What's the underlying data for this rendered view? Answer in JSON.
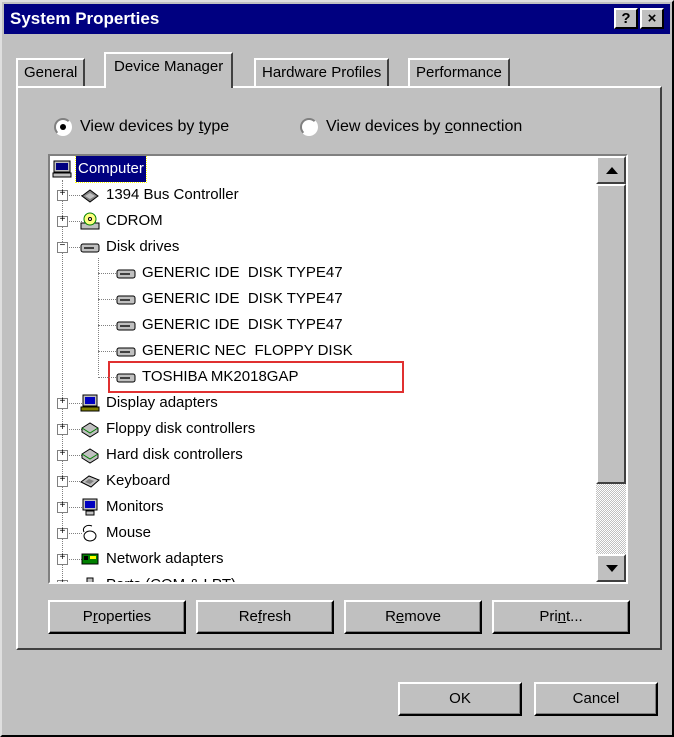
{
  "window": {
    "title": "System Properties"
  },
  "titlebar_buttons": {
    "help": "?",
    "close": "×"
  },
  "tabs": [
    {
      "label": "General",
      "active": false
    },
    {
      "label": "Device Manager",
      "active": true
    },
    {
      "label": "Hardware Profiles",
      "active": false
    },
    {
      "label": "Performance",
      "active": false
    }
  ],
  "view_options": {
    "by_type": {
      "pre": "View devices by ",
      "key": "t",
      "post": "ype",
      "checked": true
    },
    "by_connection": {
      "pre": "View devices by ",
      "key": "c",
      "post": "onnection",
      "checked": false
    }
  },
  "tree": {
    "root": "Computer",
    "items": [
      {
        "label": "1394 Bus Controller",
        "icon": "bus-controller-icon",
        "expander": "+"
      },
      {
        "label": "CDROM",
        "icon": "cdrom-icon",
        "expander": "+"
      },
      {
        "label": "Disk drives",
        "icon": "disk-drive-icon",
        "expander": "−"
      },
      {
        "label": "GENERIC IDE  DISK TYPE47",
        "icon": "disk-drive-icon",
        "child": true
      },
      {
        "label": "GENERIC IDE  DISK TYPE47",
        "icon": "disk-drive-icon",
        "child": true
      },
      {
        "label": "GENERIC IDE  DISK TYPE47",
        "icon": "disk-drive-icon",
        "child": true
      },
      {
        "label": "GENERIC NEC  FLOPPY DISK",
        "icon": "disk-drive-icon",
        "child": true
      },
      {
        "label": "TOSHIBA MK2018GAP",
        "icon": "disk-drive-icon",
        "child": true
      },
      {
        "label": "Display adapters",
        "icon": "display-adapter-icon",
        "expander": "+"
      },
      {
        "label": "Floppy disk controllers",
        "icon": "controller-icon",
        "expander": "+"
      },
      {
        "label": "Hard disk controllers",
        "icon": "controller-icon",
        "expander": "+"
      },
      {
        "label": "Keyboard",
        "icon": "keyboard-icon",
        "expander": "+"
      },
      {
        "label": "Monitors",
        "icon": "monitor-icon",
        "expander": "+"
      },
      {
        "label": "Mouse",
        "icon": "mouse-icon",
        "expander": "+"
      },
      {
        "label": "Network adapters",
        "icon": "network-adapter-icon",
        "expander": "+"
      },
      {
        "label": "Ports (COM & LPT)",
        "icon": "port-icon",
        "expander": "+"
      }
    ]
  },
  "buttons": {
    "properties": {
      "pre": "P",
      "key": "r",
      "post": "operties"
    },
    "refresh": {
      "pre": "Re",
      "key": "f",
      "post": "resh"
    },
    "remove": {
      "pre": "R",
      "key": "e",
      "post": "move"
    },
    "print": {
      "pre": "Pri",
      "key": "n",
      "post": "t..."
    },
    "ok": "OK",
    "cancel": "Cancel"
  },
  "colors": {
    "titlebar": "#000080",
    "face": "#c0c0c0",
    "highlight": "#e03030"
  }
}
